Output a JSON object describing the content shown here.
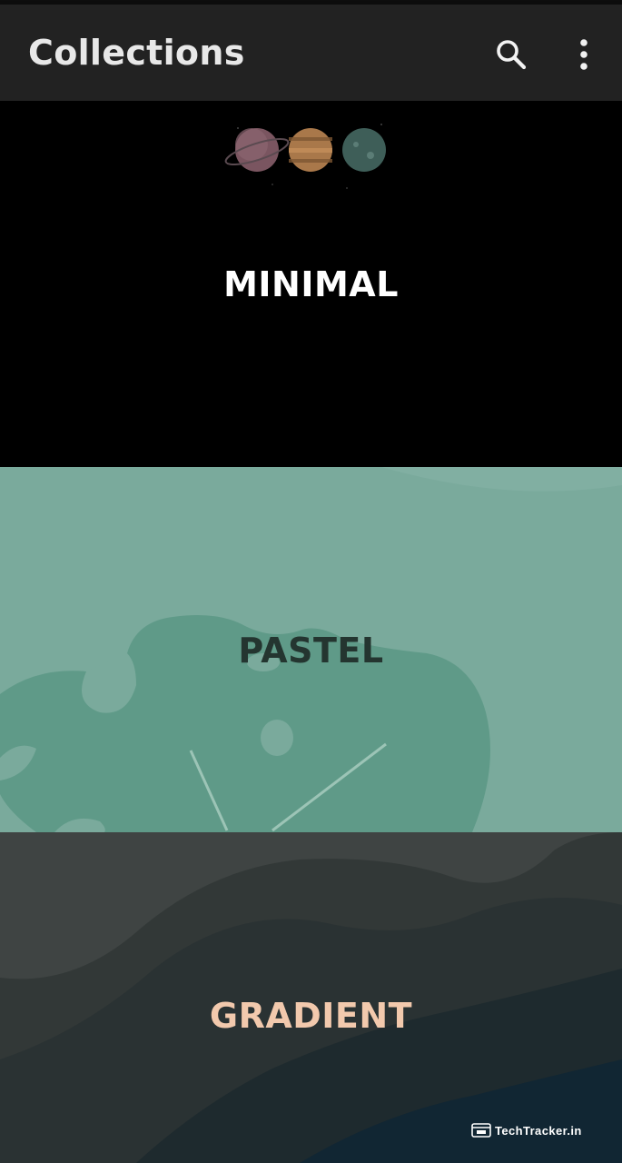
{
  "app_bar": {
    "title": "Collections",
    "actions": [
      {
        "name": "search",
        "icon": "search-icon"
      },
      {
        "name": "more",
        "icon": "more-vert-icon"
      }
    ]
  },
  "collections": [
    {
      "label": "MINIMAL",
      "label_color": "#ffffff",
      "background": "#000000"
    },
    {
      "label": "PASTEL",
      "label_color": "#243530",
      "background": "#7aaa9c"
    },
    {
      "label": "GRADIENT",
      "label_color": "#f2c9ad",
      "background": "#3a3e3d"
    }
  ],
  "watermark": {
    "text": "TechTracker.in"
  },
  "colors": {
    "app_bar": "#222222",
    "app_bar_text": "#e8e8e8"
  }
}
